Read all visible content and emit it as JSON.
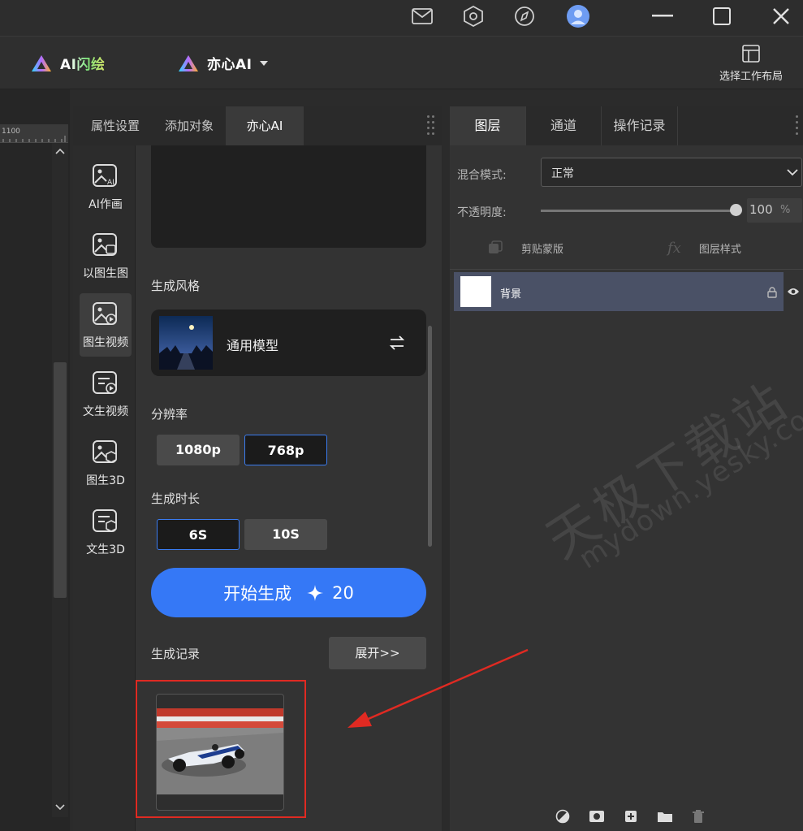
{
  "header": {
    "brand_flash": "AI闪绘",
    "brand_yixin": "亦心AI",
    "layout_button": "选择工作布局"
  },
  "ruler": {
    "mark": "1100"
  },
  "mid_panel": {
    "tabs": [
      {
        "label": "属性设置"
      },
      {
        "label": "添加对象"
      },
      {
        "label": "亦心AI"
      }
    ],
    "nav": [
      {
        "label": "AI作画"
      },
      {
        "label": "以图生图"
      },
      {
        "label": "图生视频"
      },
      {
        "label": "文生视频"
      },
      {
        "label": "图生3D"
      },
      {
        "label": "文生3D"
      }
    ],
    "style_label": "生成风格",
    "style_name": "通用模型",
    "resolution_label": "分辨率",
    "resolutions": [
      "1080p",
      "768p"
    ],
    "duration_label": "生成时长",
    "durations": [
      "6S",
      "10S"
    ],
    "generate_label": "开始生成",
    "generate_cost": "20",
    "history_label": "生成记录",
    "expand_label": "展开>>"
  },
  "right_panel": {
    "tabs": [
      {
        "label": "图层"
      },
      {
        "label": "通道"
      },
      {
        "label": "操作记录"
      }
    ],
    "blend_label": "混合模式:",
    "blend_value": "正常",
    "opacity_label": "不透明度:",
    "opacity_value": "100",
    "opacity_unit": "%",
    "opacity_level": 1.0,
    "clip_mask": "剪贴蒙版",
    "layer_style": "图层样式",
    "layer_name": "背景"
  },
  "watermark": {
    "line1": "天极下载站",
    "line2": "mydown.yesky.com"
  },
  "colors": {
    "accent_blue": "#3578f6",
    "annotation_red": "#e02a22",
    "layer_selected": "#4a5166"
  }
}
